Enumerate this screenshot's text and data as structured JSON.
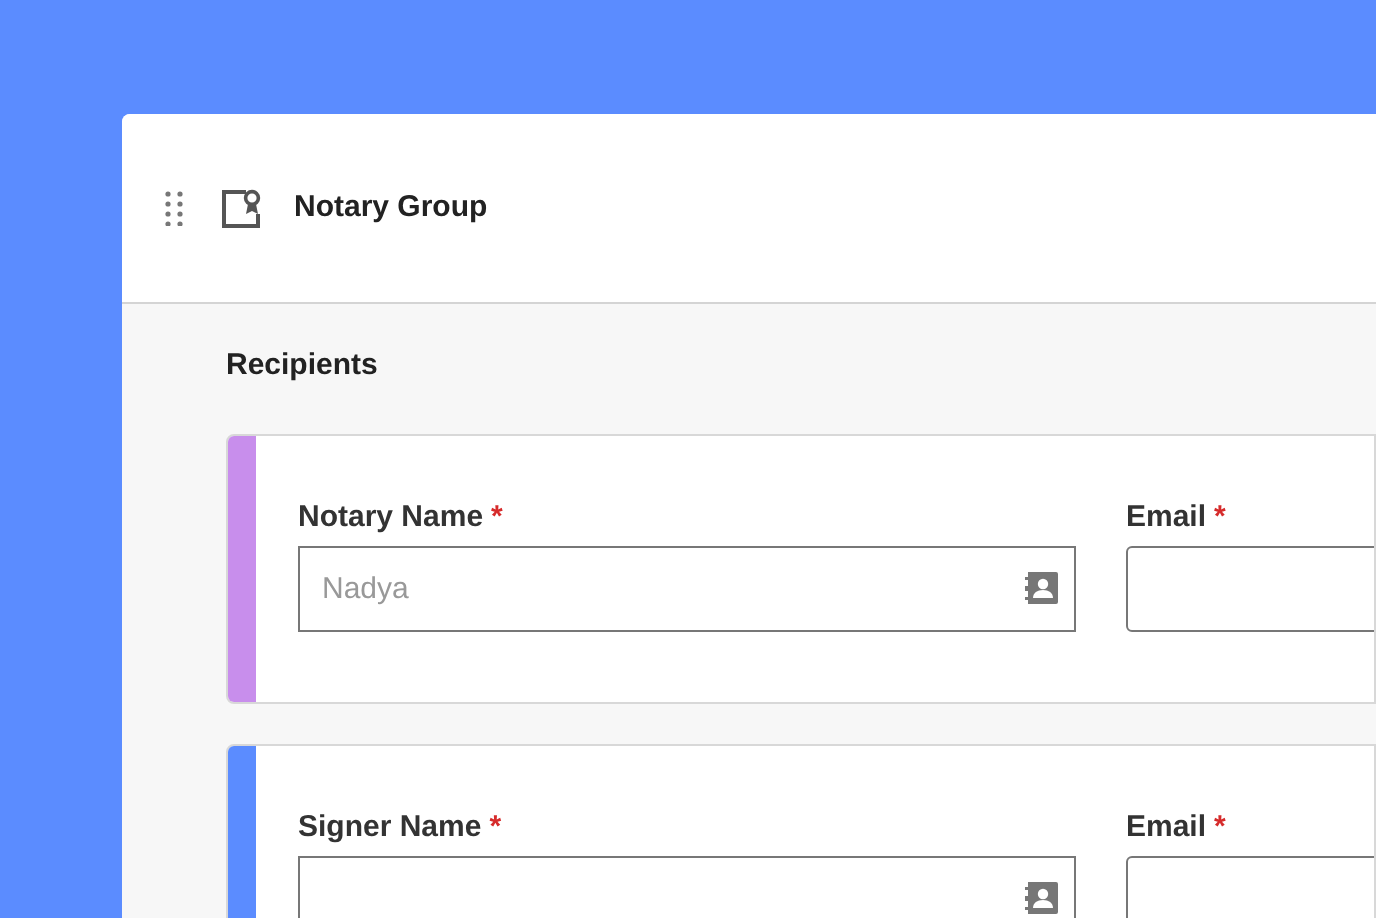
{
  "header": {
    "title": "Notary Group"
  },
  "section": {
    "title": "Recipients"
  },
  "recipients": [
    {
      "color": "#c88eec",
      "name_field": {
        "label": "Notary Name",
        "required_mark": "*",
        "placeholder": "Nadya"
      },
      "email_field": {
        "label": "Email",
        "required_mark": "*"
      }
    },
    {
      "color": "#5b8cff",
      "name_field": {
        "label": "Signer Name",
        "required_mark": "*"
      },
      "email_field": {
        "label": "Email",
        "required_mark": "*"
      }
    }
  ]
}
